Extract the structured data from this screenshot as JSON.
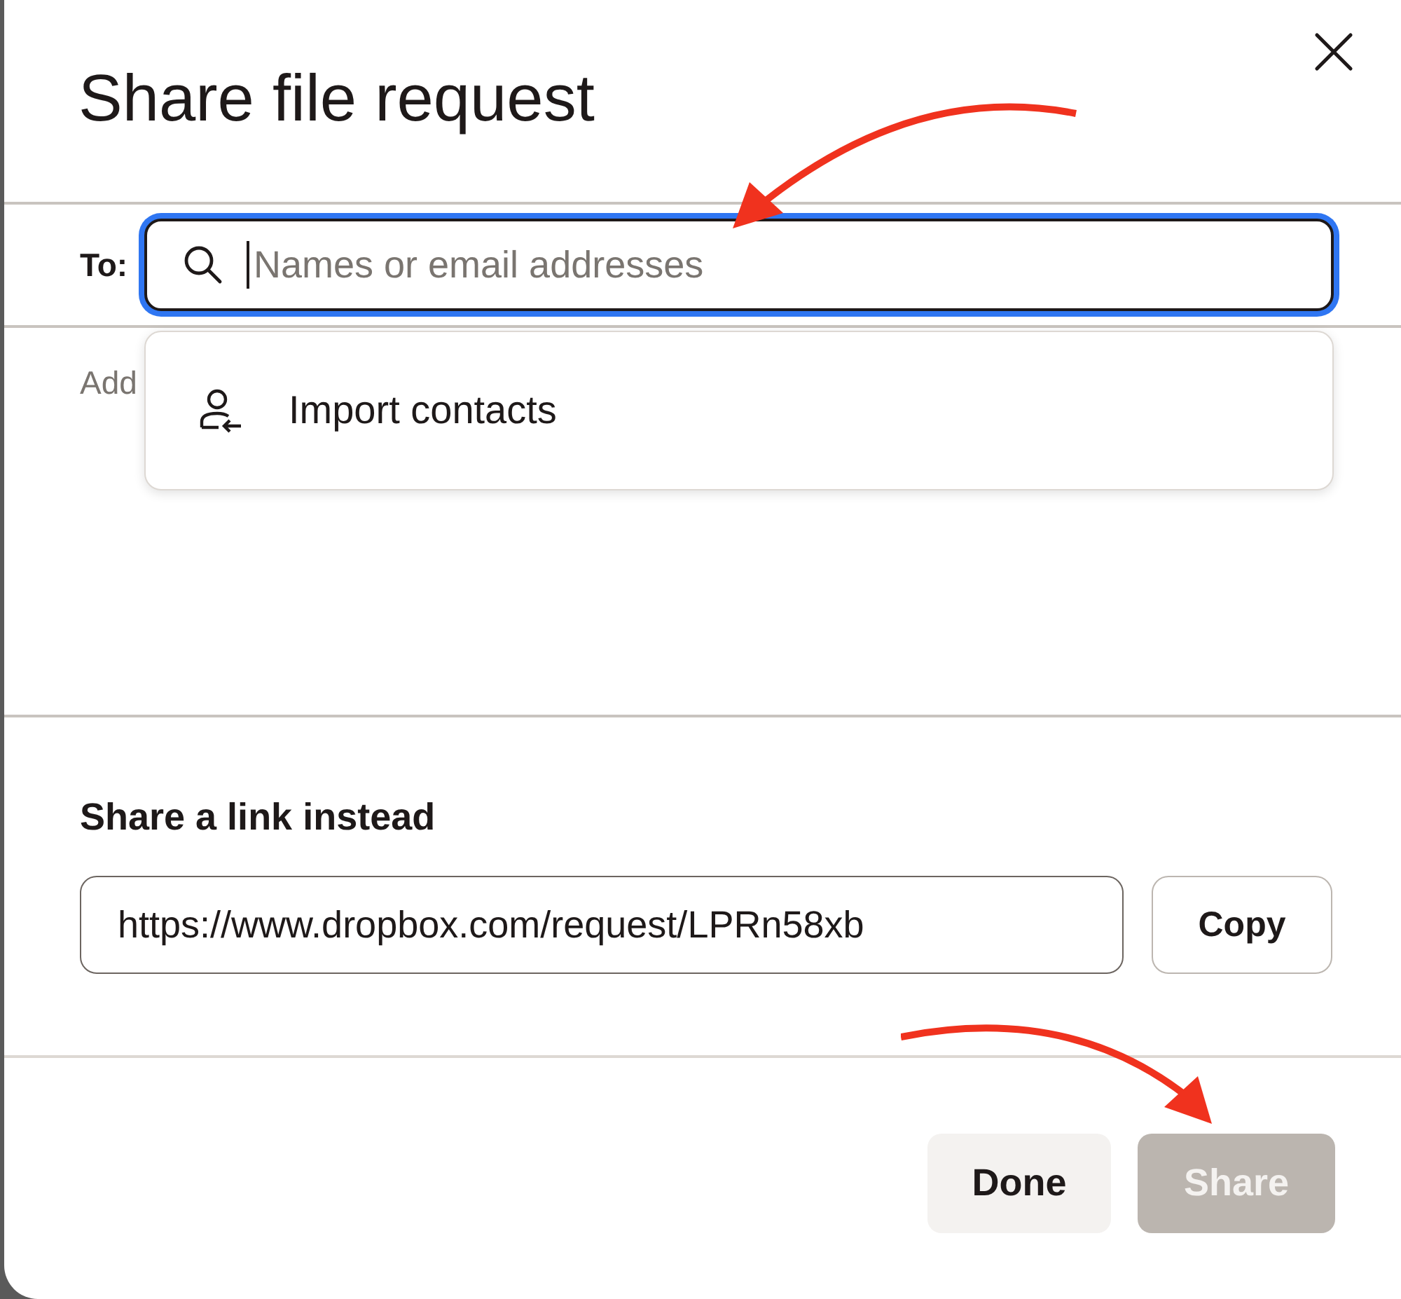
{
  "dialog": {
    "title": "Share file request"
  },
  "recipients": {
    "label": "To:",
    "placeholder": "Names or email addresses",
    "focused": true,
    "hint": "Add"
  },
  "dropdown": {
    "items": [
      {
        "label": "Import contacts"
      }
    ]
  },
  "link_section": {
    "heading": "Share a link instead",
    "url": "https://www.dropbox.com/request/LPRn58xb",
    "copy_button": "Copy"
  },
  "footer": {
    "buttons": [
      {
        "label": "Done",
        "kind": "secondary",
        "disabled": false
      },
      {
        "label": "Share",
        "kind": "primary",
        "disabled": true
      }
    ]
  }
}
